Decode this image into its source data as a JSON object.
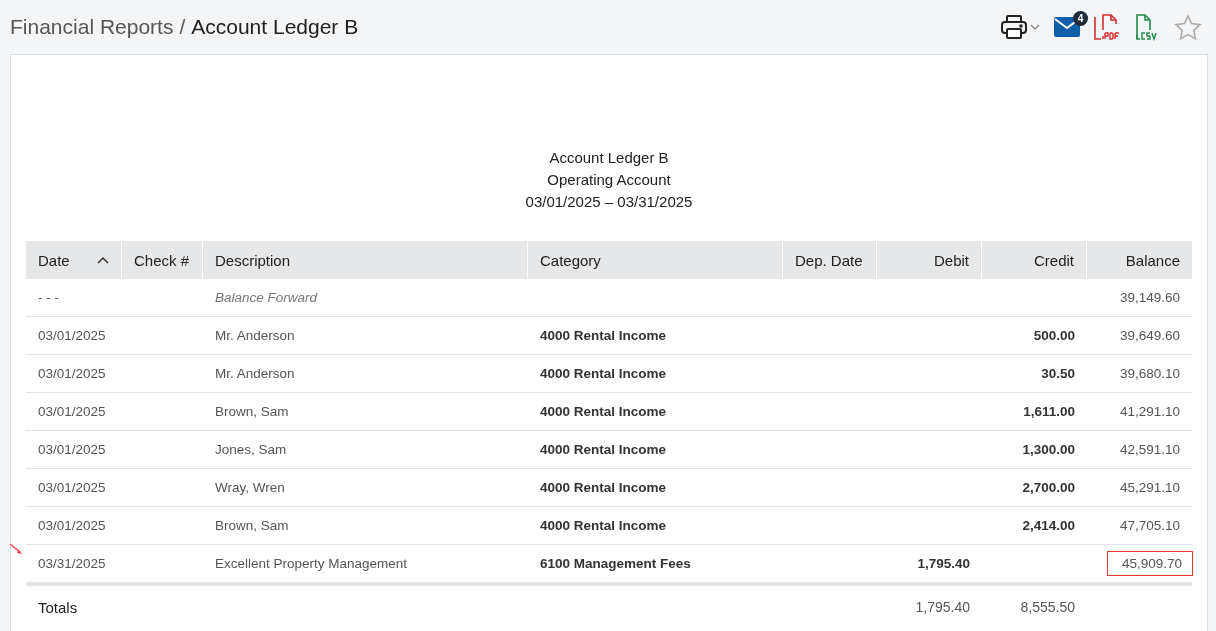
{
  "breadcrumb": {
    "parent": "Financial Reports",
    "separator": "/",
    "current": "Account Ledger B"
  },
  "toolbar": {
    "mail_badge": "4"
  },
  "report": {
    "title": "Account Ledger B",
    "subtitle": "Operating Account",
    "period": "03/01/2025 – 03/31/2025"
  },
  "table": {
    "columns": [
      {
        "label": "Date",
        "sorted": true
      },
      {
        "label": "Check #",
        "sorted": false
      },
      {
        "label": "Description",
        "sorted": false
      },
      {
        "label": "Category",
        "sorted": false
      },
      {
        "label": "Dep. Date",
        "sorted": false
      },
      {
        "label": "Debit",
        "sorted": false
      },
      {
        "label": "Credit",
        "sorted": false
      },
      {
        "label": "Balance",
        "sorted": false
      }
    ],
    "rows": [
      {
        "kind": "forward",
        "date": "- - -",
        "description": "Balance Forward",
        "balance": "39,149.60",
        "highlighted": false
      },
      {
        "kind": "entry",
        "date": "03/01/2025",
        "description": "Mr. Anderson",
        "category": "4000 Rental Income",
        "credit": "500.00",
        "balance": "39,649.60",
        "highlighted": false
      },
      {
        "kind": "entry",
        "date": "03/01/2025",
        "description": "Mr. Anderson",
        "category": "4000 Rental Income",
        "credit": "30.50",
        "balance": "39,680.10",
        "highlighted": false
      },
      {
        "kind": "entry",
        "date": "03/01/2025",
        "description": "Brown, Sam",
        "category": "4000 Rental Income",
        "credit": "1,611.00",
        "balance": "41,291.10",
        "highlighted": false
      },
      {
        "kind": "entry",
        "date": "03/01/2025",
        "description": "Jones, Sam",
        "category": "4000 Rental Income",
        "credit": "1,300.00",
        "balance": "42,591.10",
        "highlighted": false
      },
      {
        "kind": "entry",
        "date": "03/01/2025",
        "description": "Wray, Wren",
        "category": "4000 Rental Income",
        "credit": "2,700.00",
        "balance": "45,291.10",
        "highlighted": false
      },
      {
        "kind": "entry",
        "date": "03/01/2025",
        "description": "Brown, Sam",
        "category": "4000 Rental Income",
        "credit": "2,414.00",
        "balance": "47,705.10",
        "highlighted": false
      },
      {
        "kind": "entry",
        "date": "03/31/2025",
        "description": "Excellent Property Management",
        "category": "6100 Management Fees",
        "debit": "1,795.40",
        "balance": "45,909.70",
        "highlighted": true
      }
    ],
    "totals": {
      "label": "Totals",
      "debit": "1,795.40",
      "credit": "8,555.50"
    }
  }
}
